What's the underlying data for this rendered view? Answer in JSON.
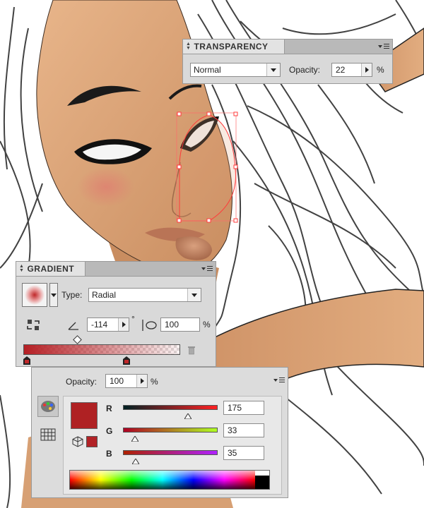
{
  "transparency_panel": {
    "title": "TRANSPARENCY",
    "blend_mode": "Normal",
    "opacity_label": "Opacity:",
    "opacity_value": "22",
    "unit": "%"
  },
  "gradient_panel": {
    "title": "GRADIENT",
    "type_label": "Type:",
    "type_value": "Radial",
    "angle_value": "-114",
    "degree_symbol": "°",
    "aspect_value": "100",
    "unit": "%"
  },
  "color_panel": {
    "opacity_label": "Opacity:",
    "opacity_value": "100",
    "unit": "%",
    "fill_color": "#af2123",
    "channels": [
      {
        "label": "R",
        "value": "175",
        "fraction": 0.686
      },
      {
        "label": "G",
        "value": "33",
        "fraction": 0.129
      },
      {
        "label": "B",
        "value": "35",
        "fraction": 0.137
      }
    ]
  },
  "colors": {
    "skin": "#dba47a",
    "panel_bg": "#d9d9d9",
    "selection": "#ff3b3b"
  }
}
